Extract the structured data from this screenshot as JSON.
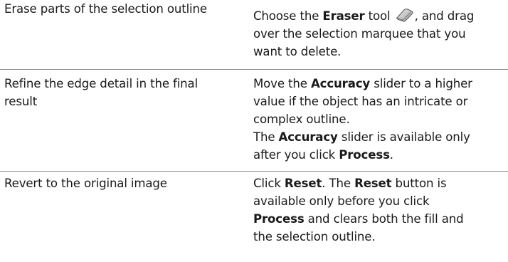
{
  "rows": [
    {
      "task": [
        "Erase parts of the selection outline"
      ],
      "description": {
        "l1_pre": "Choose the ",
        "l1_bold": "Eraser",
        "l1_mid": " tool ",
        "l1_post": ", and drag",
        "l2": "over the selection marquee that you",
        "l3": "want to delete."
      },
      "icon": "eraser-icon"
    },
    {
      "task": [
        "Refine the edge detail in the final",
        "result"
      ],
      "description": {
        "l1_pre": "Move the ",
        "l1_bold": "Accuracy",
        "l1_post": " slider to a higher",
        "l2": "value if the object has an intricate or",
        "l3": "complex outline.",
        "l4_pre": "The ",
        "l4_bold": "Accuracy",
        "l4_post": " slider is available only",
        "l5_pre": "after you click ",
        "l5_bold": "Process",
        "l5_post": "."
      }
    },
    {
      "task": [
        "Revert to the original image"
      ],
      "description": {
        "l1_pre": "Click ",
        "l1_bold": "Reset",
        "l1_mid": ". The ",
        "l1_bold2": "Reset",
        "l1_post": " button is",
        "l2": "available only before you click",
        "l3_bold": "Process",
        "l3_post": " and clears both the fill and",
        "l4": "the selection outline."
      }
    }
  ]
}
